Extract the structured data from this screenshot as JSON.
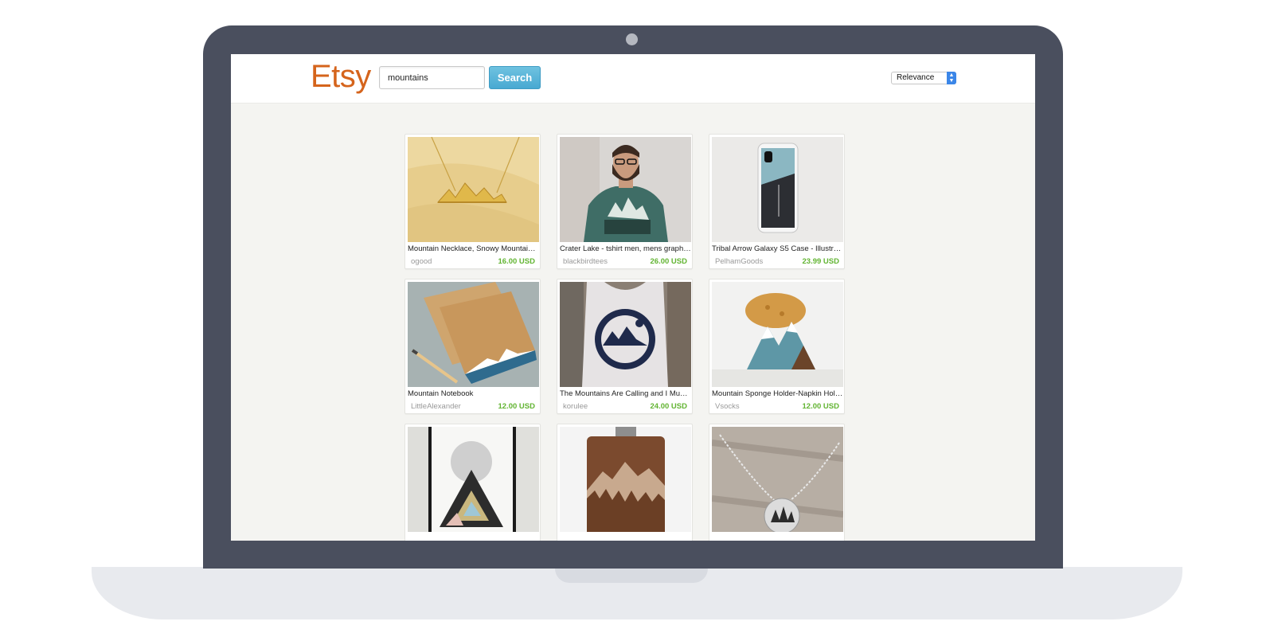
{
  "app": {
    "logo_text": "Etsy",
    "accent_color": "#d5641c",
    "price_color": "#62b432"
  },
  "search": {
    "value": "mountains",
    "button_label": "Search"
  },
  "sort": {
    "selected": "Relevance"
  },
  "listings": [
    {
      "title": "Mountain Necklace, Snowy Mountain ...",
      "shop": "ogood",
      "price": "16.00 USD",
      "image": "gold-mountain-necklace"
    },
    {
      "title": "Crater Lake - tshirt men, mens graphi...",
      "shop": "blackbirdtees",
      "price": "26.00 USD",
      "image": "man-teal-tshirt"
    },
    {
      "title": "Tribal Arrow Galaxy S5 Case - Illustra...",
      "shop": "PelhamGoods",
      "price": "23.99 USD",
      "image": "phone-case"
    },
    {
      "title": "Mountain Notebook",
      "shop": "LittleAlexander",
      "price": "12.00 USD",
      "image": "kraft-notebooks"
    },
    {
      "title": "The Mountains Are Calling and I Must...",
      "shop": "korulee",
      "price": "24.00 USD",
      "image": "tank-top"
    },
    {
      "title": "Mountain Sponge Holder-Napkin Hold...",
      "shop": "Vsocks",
      "price": "12.00 USD",
      "image": "wooden-mountain-sponge-holder"
    },
    {
      "title": "",
      "shop": "",
      "price": "",
      "image": "geometric-mountain-print"
    },
    {
      "title": "",
      "shop": "",
      "price": "",
      "image": "wooden-flask"
    },
    {
      "title": "",
      "shop": "",
      "price": "",
      "image": "silver-tree-pendant"
    }
  ]
}
